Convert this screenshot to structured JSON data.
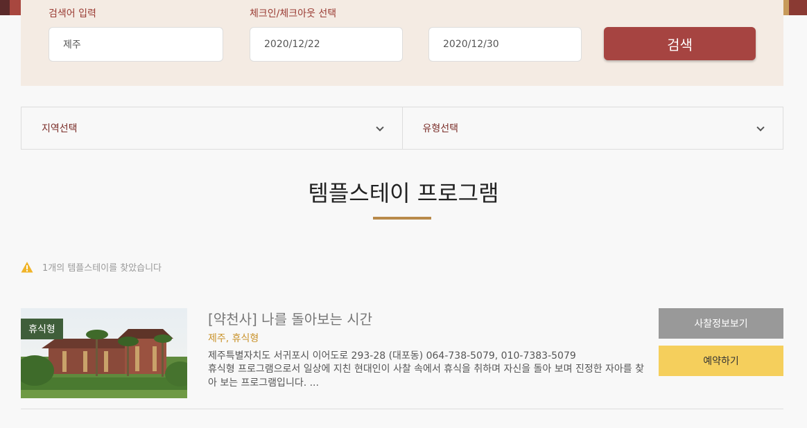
{
  "search": {
    "keyword_label": "검색어 입력",
    "keyword_value": "제주",
    "date_label": "체크인/체크아웃 선택",
    "checkin_value": "2020/12/22",
    "checkout_value": "2020/12/30",
    "search_button": "검색"
  },
  "filters": {
    "region": "지역선택",
    "type": "유형선택"
  },
  "section": {
    "title": "템플스테이 프로그램"
  },
  "notice": {
    "text": "1개의 템플스테이를 찾았습니다"
  },
  "results": [
    {
      "badge": "휴식형",
      "title": "[약천사] 나를 돌아보는 시간",
      "tags": "제주, 휴식형",
      "address": "제주특별자치도 서귀포시 이어도로 293-28 (대포동) 064-738-5079, 010-7383-5079",
      "description": "휴식형 프로그램으로서 일상에 지친 현대인이 사찰 속에서 휴식을 취하며 자신을 돌아 보며 진정한 자아를 찾아 보는 프로그램입니다. ...",
      "info_button": "사찰정보보기",
      "book_button": "예약하기"
    }
  ],
  "colors": {
    "accent": "#a64441",
    "panel": "#f4ebe3",
    "badge": "#3f5e3a",
    "book": "#f5cf5c"
  },
  "icons": {
    "notice": "warning-icon",
    "dropdown": "chevron-down-icon"
  }
}
